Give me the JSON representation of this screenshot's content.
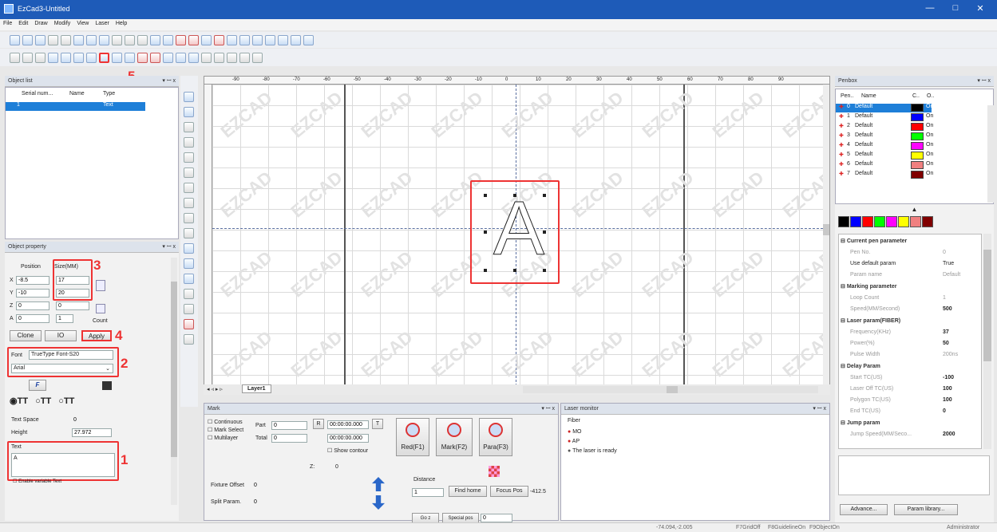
{
  "window": {
    "title": "EzCad3-Untitled",
    "min": "—",
    "max": "□",
    "close": "✕"
  },
  "menu": [
    "File",
    "Edit",
    "Draw",
    "Modify",
    "View",
    "Laser",
    "Help"
  ],
  "object_list": {
    "title": "Object list",
    "pin": "▾ ꟷ x",
    "cols": [
      "Serial num...",
      "Name",
      "Type"
    ],
    "row": {
      "serial": "1",
      "name": "",
      "type": "Text"
    }
  },
  "object_property": {
    "title": "Object property",
    "position_label": "Position",
    "size_label": "Size(MM)",
    "x_label": "X",
    "y_label": "Y",
    "z_label": "Z",
    "a_label": "A",
    "x": "-8.5",
    "y": "-10",
    "z": "0",
    "a": "0",
    "size_x": "17",
    "size_y": "20",
    "size_z": "0",
    "count": "1",
    "count_label": "Count",
    "clone": "Clone",
    "io": "IO",
    "apply": "Apply",
    "font_label": "Font",
    "font_type": "TrueType Font-S20",
    "font_name": "Arial",
    "text_space_label": "Text Space",
    "text_space": "0",
    "height_label": "Height",
    "height": "27.972",
    "text_label": "Text",
    "text_value": "A",
    "enable_variable": "Enable variable Text",
    "f_button": "F",
    "tt": "TT"
  },
  "annotations": [
    "1",
    "2",
    "3",
    "4",
    "5"
  ],
  "canvas": {
    "layer_tab": "Layer1",
    "watermark": "EZCAD",
    "glyph": "A",
    "ruler_labels": [
      "-90",
      "-80",
      "-70",
      "-60",
      "-50",
      "-40",
      "-30",
      "-20",
      "-10",
      "0",
      "10",
      "20",
      "30",
      "40",
      "50",
      "60",
      "70",
      "80",
      "90"
    ]
  },
  "mark": {
    "title": "Mark",
    "continuous": "Continuous",
    "mark_select": "Mark Select",
    "multilayer": "Multilayer",
    "part_label": "Part",
    "part": "0",
    "total_label": "Total",
    "total": "0",
    "r": "R",
    "t": "T",
    "time1": "00:00:00.000",
    "time2": "00:00:00.000",
    "show_contour": "Show contour",
    "red": "Red(F1)",
    "markbtn": "Mark(F2)",
    "para": "Para(F3)",
    "z_label": "Z:",
    "z": "0",
    "distance_label": "Distance",
    "distance": "1",
    "find_home": "Find home",
    "focus_pos": "Focus Pos",
    "focus_val": "-412.5",
    "fixture_offset": "Fixture Offset",
    "fixture_val": "0",
    "split_param": "Split Param.",
    "split_val": "0",
    "go_z": "Go z",
    "special_pos": "Special pos",
    "special_val": "0"
  },
  "laser_monitor": {
    "title": "Laser monitor",
    "fiber": "Fiber",
    "items": [
      "MO",
      "AP",
      "The laser is ready"
    ]
  },
  "penbox": {
    "title": "Penbox",
    "cols": [
      "Pen..",
      "Name",
      "C..",
      "O.."
    ],
    "pens": [
      {
        "no": "0",
        "name": "Default",
        "color": "#000000",
        "on": "On"
      },
      {
        "no": "1",
        "name": "Default",
        "color": "#0000ff",
        "on": "On"
      },
      {
        "no": "2",
        "name": "Default",
        "color": "#ff0000",
        "on": "On"
      },
      {
        "no": "3",
        "name": "Default",
        "color": "#00ff00",
        "on": "On"
      },
      {
        "no": "4",
        "name": "Default",
        "color": "#ff00ff",
        "on": "On"
      },
      {
        "no": "5",
        "name": "Default",
        "color": "#ffff00",
        "on": "On"
      },
      {
        "no": "6",
        "name": "Default",
        "color": "#f08080",
        "on": "On"
      },
      {
        "no": "7",
        "name": "Default",
        "color": "#800000",
        "on": "On"
      }
    ],
    "swatches": [
      "#000000",
      "#0000ff",
      "#ff0000",
      "#00ff00",
      "#ff00ff",
      "#ffff00",
      "#f08080",
      "#800000"
    ]
  },
  "params": {
    "current": "Current pen parameter",
    "pen_no_l": "Pen No.",
    "pen_no": "0",
    "use_default_l": "Use default param",
    "use_default": "True",
    "param_name_l": "Param name",
    "param_name": "Default",
    "marking": "Marking parameter",
    "loop_l": "Loop Count",
    "loop": "1",
    "speed_l": "Speed(MM/Second)",
    "speed": "500",
    "laser": "Laser param(FIBER)",
    "freq_l": "Frequency(KHz)",
    "freq": "37",
    "power_l": "Power(%)",
    "power": "50",
    "pulse_l": "Pulse Width",
    "pulse": "200ns",
    "delay": "Delay Param",
    "start_l": "Start TC(US)",
    "start": "-100",
    "off_l": "Laser Off TC(US)",
    "off": "100",
    "poly_l": "Polygon TC(US)",
    "poly": "100",
    "end_l": "End TC(US)",
    "end": "0",
    "jump": "Jump param",
    "jump_l": "Jump Speed(MM/Seco...",
    "jump_v": "2000"
  },
  "advance": "Advance...",
  "library": "Param library...",
  "status": {
    "coords": "-74.094,-2.005",
    "grid": "F7GridOff",
    "guide": "F8GuidelineOn",
    "obj": "F9ObjectOn",
    "user": "Administrator"
  }
}
